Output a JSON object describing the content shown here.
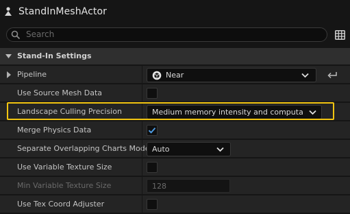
{
  "window": {
    "title": "StandInMeshActor"
  },
  "search": {
    "placeholder": "Search"
  },
  "section": {
    "title": "Stand-In Settings"
  },
  "properties": [
    {
      "label": "Pipeline",
      "type": "combo",
      "value": "Near",
      "icon": "near-pipeline-icon",
      "resettable": true,
      "expandable": true
    },
    {
      "label": "Use Source Mesh Data",
      "type": "checkbox",
      "checked": false
    },
    {
      "label": "Landscape Culling Precision",
      "type": "combo",
      "value": "Medium memory intensity and computation time",
      "highlighted": true
    },
    {
      "label": "Merge Physics Data",
      "type": "checkbox",
      "checked": true
    },
    {
      "label": "Separate Overlapping Charts Mode",
      "type": "combo",
      "value": "Auto"
    },
    {
      "label": "Use Variable Texture Size",
      "type": "checkbox",
      "checked": false
    },
    {
      "label": "Min Variable Texture Size",
      "type": "number",
      "value": "128",
      "disabled": true
    },
    {
      "label": "Use Tex Coord Adjuster",
      "type": "checkbox",
      "checked": false
    }
  ],
  "colors": {
    "highlight": "#f2c511",
    "check": "#4f9fe8"
  }
}
